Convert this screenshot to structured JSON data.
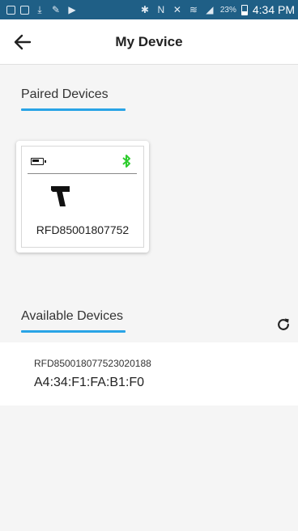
{
  "status_bar": {
    "battery_percent": "23%",
    "time": "4:34 PM"
  },
  "header": {
    "title": "My Device",
    "back_icon": "arrow-left-icon"
  },
  "paired_section": {
    "title": "Paired Devices",
    "devices": [
      {
        "name": "RFD85001807752",
        "battery_icon": "battery-icon",
        "bluetooth_icon": "bluetooth-icon",
        "device_icon": "scanner-gun-icon",
        "bluetooth_color": "#2ecc2e"
      }
    ]
  },
  "available_section": {
    "title": "Available Devices",
    "refresh_icon": "refresh-icon",
    "devices": [
      {
        "name": "RFD850018077523020188",
        "mac": "A4:34:F1:FA:B1:F0"
      }
    ]
  },
  "colors": {
    "status_bar": "#1f5f86",
    "accent": "#29a4e6",
    "bluetooth": "#2ecc2e"
  }
}
